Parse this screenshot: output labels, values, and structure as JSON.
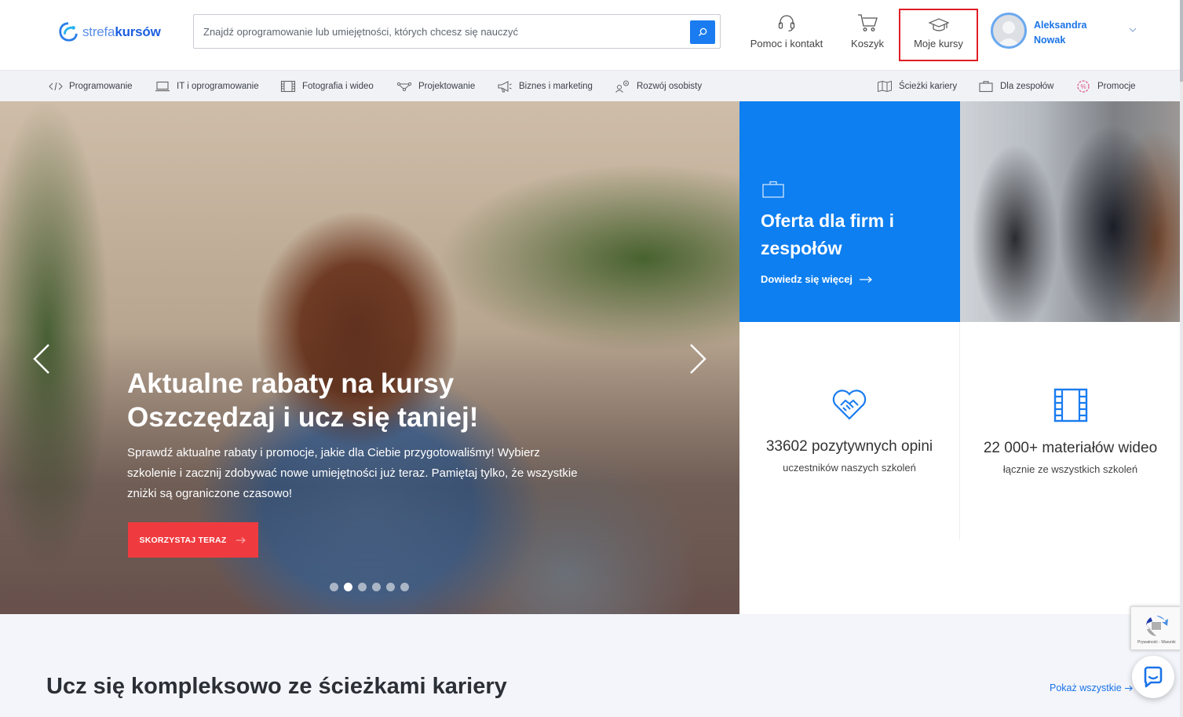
{
  "header": {
    "logo_text_light": "strefa",
    "logo_text_bold": "kursów",
    "search": {
      "placeholder": "Znajdź oprogramowanie lub umiejętności, których chcesz się nauczyć"
    },
    "help_label": "Pomoc i kontakt",
    "cart_label": "Koszyk",
    "my_courses_label": "Moje kursy",
    "user": {
      "first_name": "Aleksandra",
      "last_name": "Nowak"
    }
  },
  "categories": [
    {
      "label": "Programowanie",
      "icon": "code-icon"
    },
    {
      "label": "IT i oprogramowanie",
      "icon": "laptop-icon"
    },
    {
      "label": "Fotografia i wideo",
      "icon": "film-icon"
    },
    {
      "label": "Projektowanie",
      "icon": "design-icon"
    },
    {
      "label": "Biznes i marketing",
      "icon": "megaphone-icon"
    },
    {
      "label": "Rozwój osobisty",
      "icon": "person-growth-icon"
    }
  ],
  "secondary_nav": [
    {
      "label": "Ścieżki kariery",
      "icon": "map-icon"
    },
    {
      "label": "Dla zespołów",
      "icon": "briefcase-icon"
    },
    {
      "label": "Promocje",
      "icon": "promo-badge-icon"
    }
  ],
  "hero": {
    "title_line1": "Aktualne rabaty na kursy",
    "title_line2": "Oszczędzaj i ucz się taniej!",
    "text": "Sprawdź aktualne rabaty i promocje, jakie dla Ciebie przygotowaliśmy! Wybierz szkolenie i zacznij zdobywać nowe umiejętności już teraz. Pamiętaj tylko, że wszystkie zniżki są ograniczone czasowo!",
    "cta_label": "SKORZYSTAJ TERAZ",
    "slide_count": 6,
    "active_slide": 2
  },
  "b2b": {
    "title": "Oferta dla firm i zespołów",
    "link_label": "Dowiedz się więcej"
  },
  "stats": [
    {
      "value": "33602 pozytywnych opini",
      "sub": "uczestników naszych szkoleń",
      "icon": "handshake-heart-icon"
    },
    {
      "value": "22 000+ materiałów wideo",
      "sub": "łącznie ze wszystkich szkoleń",
      "icon": "film-strip-icon"
    }
  ],
  "career_section": {
    "title": "Ucz się kompleksowo ze ścieżkami kariery",
    "show_all_label": "Pokaż wszystkie"
  },
  "recaptcha_text": "Prywatność - Warunki",
  "colors": {
    "brand_blue": "#1a7cf0",
    "cta_red": "#ef3b3f",
    "highlight_border": "#e01e26"
  }
}
